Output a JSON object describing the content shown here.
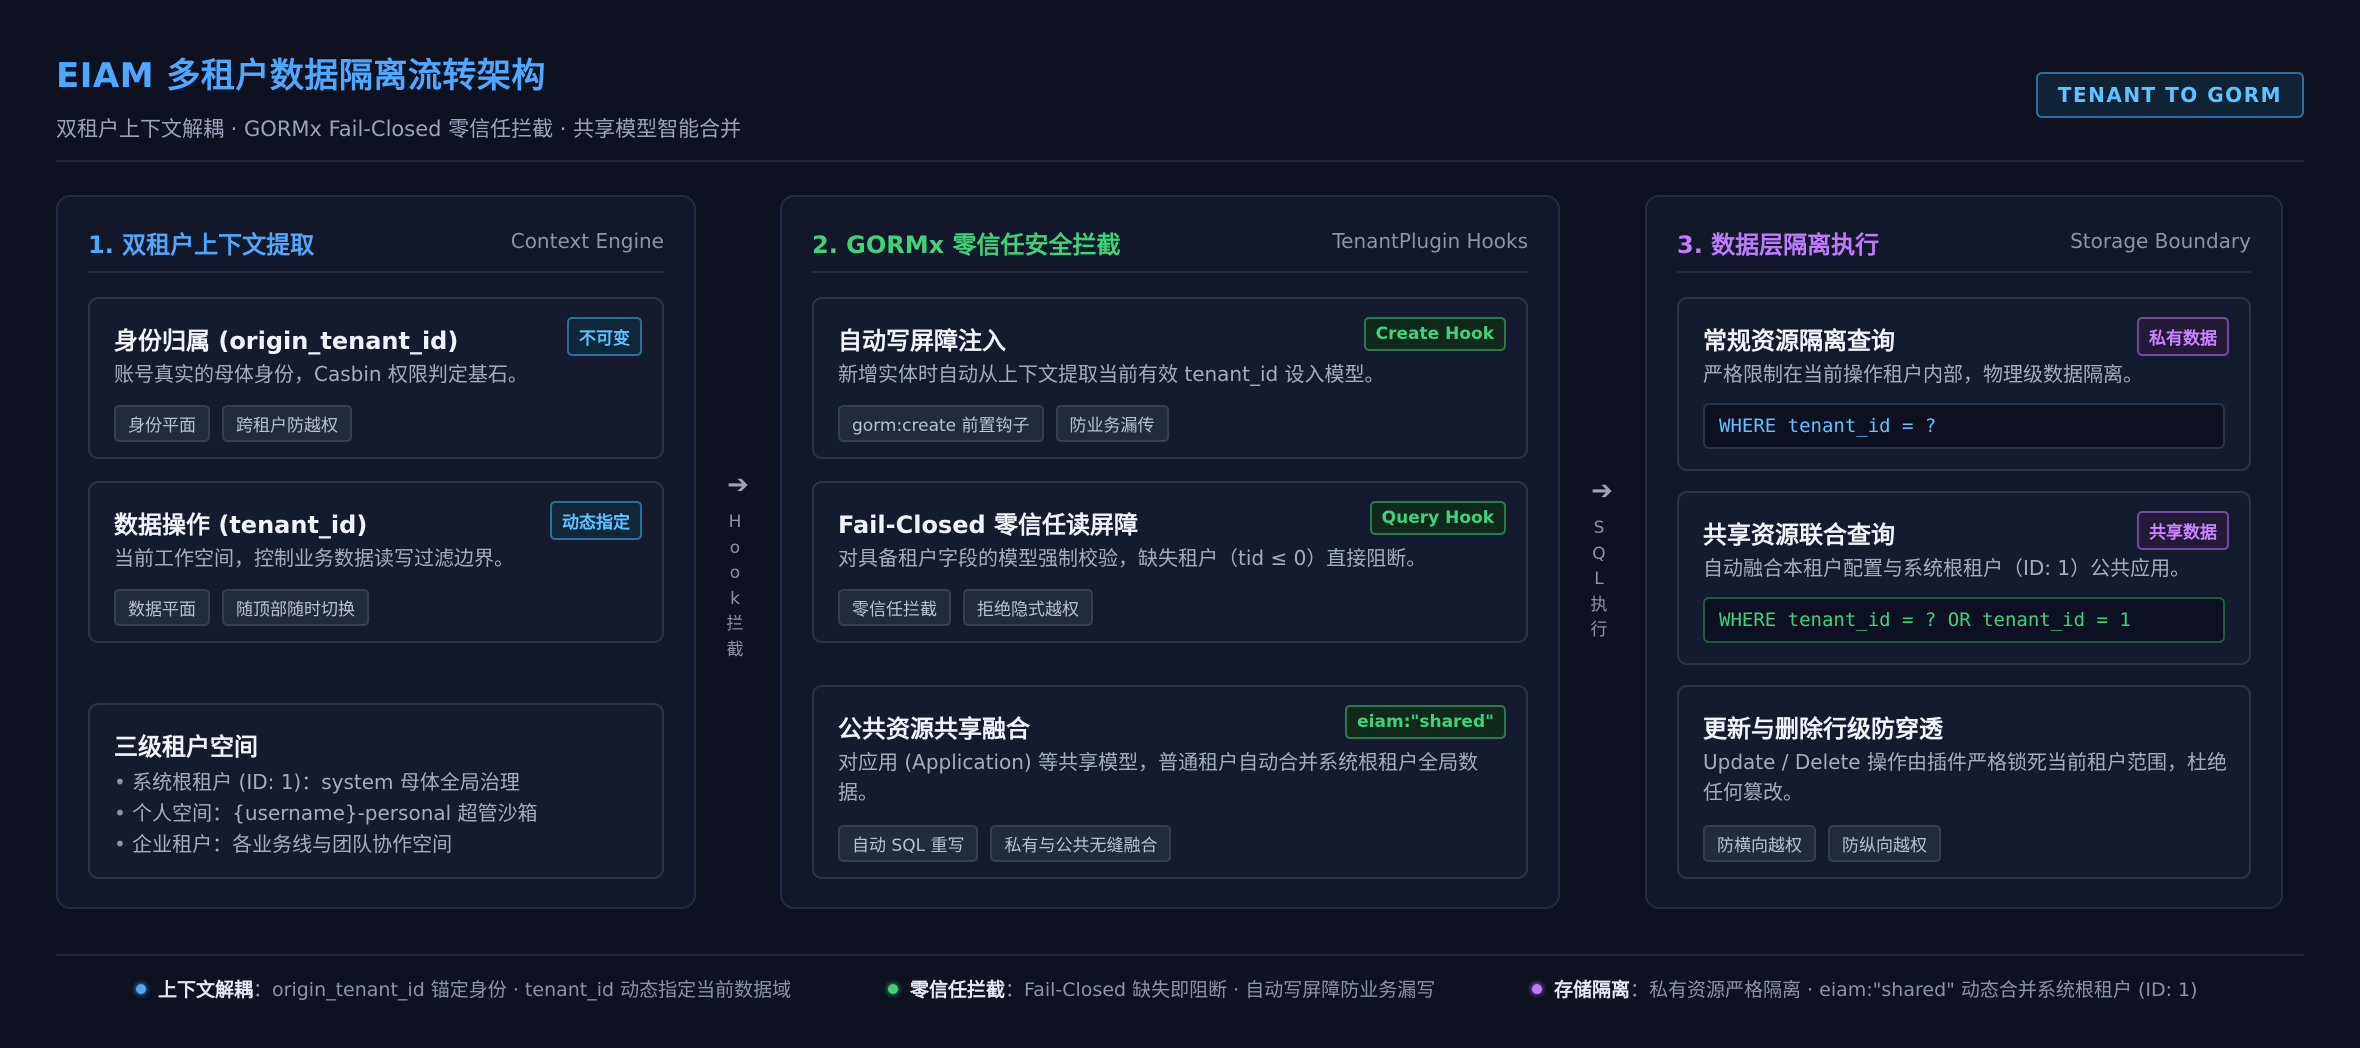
{
  "header": {
    "title": "EIAM 多租户数据隔离流转架构",
    "subtitle": "双租户上下文解耦 · GORMx Fail-Closed 零信任拦截 · 共享模型智能合并",
    "badge": "TENANT TO GORM"
  },
  "columns": [
    {
      "title": "1. 双租户上下文提取",
      "tag": "Context Engine",
      "cards": [
        {
          "title": "身份归属 (origin_tenant_id)",
          "badge": "不可变",
          "desc": "账号真实的母体身份，Casbin 权限判定基石。",
          "pills": [
            "身份平面",
            "跨租户防越权"
          ]
        },
        {
          "title": "数据操作 (tenant_id)",
          "badge": "动态指定",
          "desc": "当前工作空间，控制业务数据读写过滤边界。",
          "pills": [
            "数据平面",
            "随顶部随时切换"
          ]
        },
        {
          "title": "三级租户空间",
          "items": [
            "系统根租户 (ID: 1)：system 母体全局治理",
            "个人空间：{username}-personal 超管沙箱",
            "企业租户：各业务线与团队协作空间"
          ]
        }
      ]
    },
    {
      "title": "2. GORMx 零信任安全拦截",
      "tag": "TenantPlugin Hooks",
      "cards": [
        {
          "title": "自动写屏障注入",
          "badge": "Create Hook",
          "desc": "新增实体时自动从上下文提取当前有效 tenant_id 设入模型。",
          "pills": [
            "gorm:create 前置钩子",
            "防业务漏传"
          ]
        },
        {
          "title": "Fail-Closed 零信任读屏障",
          "badge": "Query Hook",
          "desc": "对具备租户字段的模型强制校验，缺失租户（tid ≤ 0）直接阻断。",
          "pills": [
            "零信任拦截",
            "拒绝隐式越权"
          ]
        },
        {
          "title": "公共资源共享融合",
          "badge": "eiam:\"shared\"",
          "desc": "对应用 (Application) 等共享模型，普通租户自动合并系统根租户全局数据。",
          "pills": [
            "自动 SQL 重写",
            "私有与公共无缝融合"
          ]
        }
      ]
    },
    {
      "title": "3. 数据层隔离执行",
      "tag": "Storage Boundary",
      "cards": [
        {
          "title": "常规资源隔离查询",
          "badge": "私有数据",
          "desc": "严格限制在当前操作租户内部，物理级数据隔离。",
          "code": "WHERE tenant_id = ?"
        },
        {
          "title": "共享资源联合查询",
          "badge": "共享数据",
          "desc": "自动融合本租户配置与系统根租户（ID: 1）公共应用。",
          "code": "WHERE tenant_id = ? OR tenant_id = 1"
        },
        {
          "title": "更新与删除行级防穿透",
          "desc": "Update / Delete 操作由插件严格锁死当前租户范围，杜绝任何篡改。",
          "pills": [
            "防横向越权",
            "防纵向越权"
          ]
        }
      ]
    }
  ],
  "connectors": [
    {
      "arrow": "➔",
      "text": [
        "H",
        "o",
        "o",
        "k",
        "拦",
        "截"
      ]
    },
    {
      "arrow": "➔",
      "text": [
        "S",
        "Q",
        "L",
        "执",
        "行"
      ]
    }
  ],
  "footer": [
    {
      "label": "上下文解耦",
      "text": "：origin_tenant_id 锚定身份 · tenant_id 动态指定当前数据域",
      "color": "#4fa8ff"
    },
    {
      "label": "零信任拦截",
      "text": "：Fail-Closed 缺失即阻断 · 自动写屏障防业务漏写",
      "color": "#3ed27a"
    },
    {
      "label": "存储隔离",
      "text": "：私有资源严格隔离 · eiam:\"shared\" 动态合并系统根租户 (ID: 1)",
      "color": "#c07cff"
    }
  ]
}
